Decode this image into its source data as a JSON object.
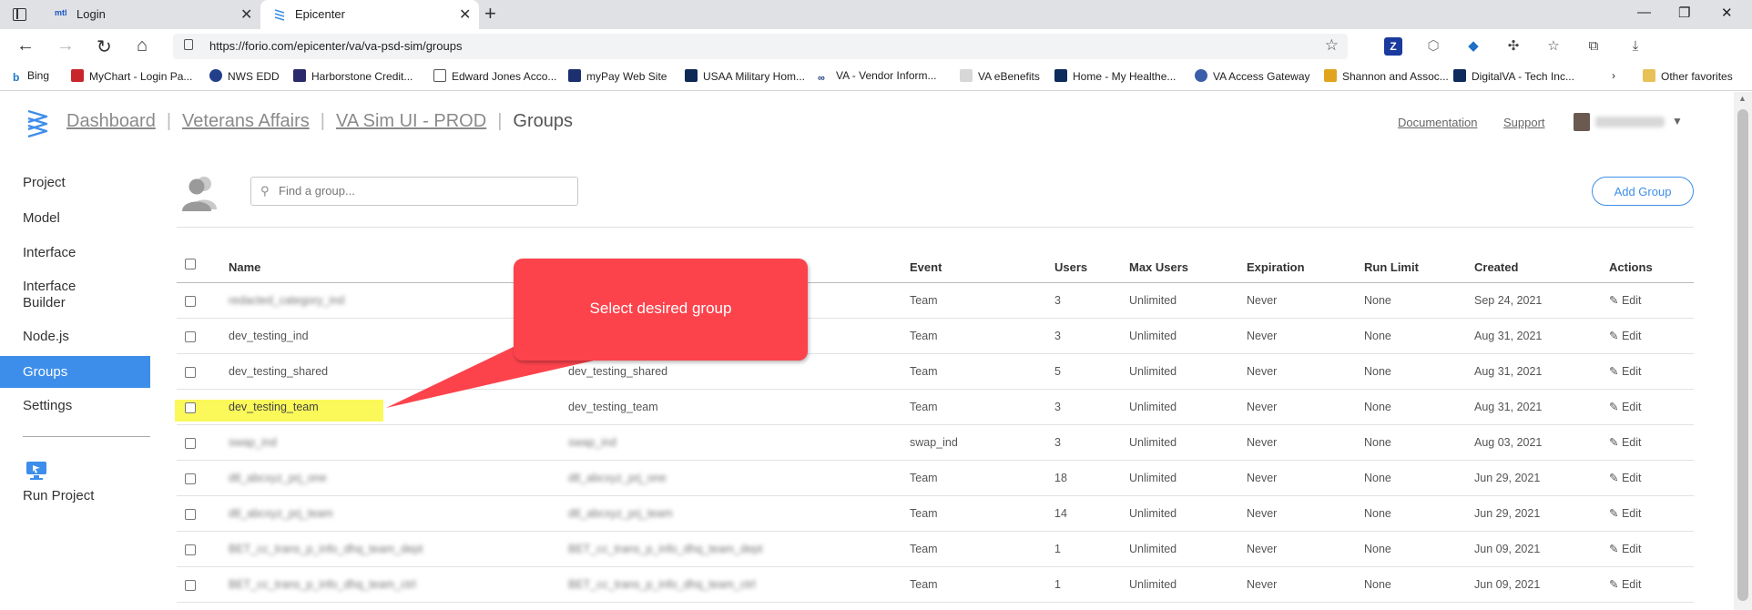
{
  "browser": {
    "tabs": [
      {
        "label": "Login",
        "favicon": "mtl"
      },
      {
        "label": "Epicenter",
        "active": true
      }
    ],
    "url": "https://forio.com/epicenter/va/va-psd-sim/groups",
    "favorites": [
      "Bing",
      "MyChart - Login Pa...",
      "NWS EDD",
      "Harborstone Credit...",
      "Edward Jones Acco...",
      "myPay Web Site",
      "USAA Military Hom...",
      "VA - Vendor Inform...",
      "VA eBenefits",
      "Home - My Healthe...",
      "VA Access Gateway",
      "Shannon and Assoc...",
      "DigitalVA - Tech Inc..."
    ],
    "other_favorites": "Other favorites"
  },
  "header": {
    "breadcrumb": {
      "dashboard": "Dashboard",
      "account": "Veterans Affairs",
      "project": "VA Sim UI - PROD",
      "current": "Groups"
    },
    "documentation": "Documentation",
    "support": "Support"
  },
  "sidebar": {
    "items": [
      {
        "label": "Project"
      },
      {
        "label": "Model"
      },
      {
        "label": "Interface"
      },
      {
        "label": "Interface Builder"
      },
      {
        "label": "Node.js"
      },
      {
        "label": "Groups",
        "active": true
      },
      {
        "label": "Settings"
      }
    ],
    "run_project": "Run Project"
  },
  "toolbar": {
    "search_placeholder": "Find a group...",
    "add_group": "Add Group"
  },
  "table": {
    "columns": [
      "Name",
      "Event",
      "Users",
      "Max Users",
      "Expiration",
      "Run Limit",
      "Created",
      "Actions"
    ],
    "edit_label": "Edit",
    "rows": [
      {
        "name": "redacted_category_ind",
        "event": "Team",
        "users": "3",
        "max_users": "Unlimited",
        "expiration": "Never",
        "run_limit": "None",
        "created": "Sep 24, 2021",
        "blurred_name": true
      },
      {
        "name": "dev_testing_ind",
        "event": "Team",
        "users": "3",
        "max_users": "Unlimited",
        "expiration": "Never",
        "run_limit": "None",
        "created": "Aug 31, 2021"
      },
      {
        "name": "dev_testing_shared",
        "display": "dev_testing_shared",
        "event": "Team",
        "users": "5",
        "max_users": "Unlimited",
        "expiration": "Never",
        "run_limit": "None",
        "created": "Aug 31, 2021"
      },
      {
        "name": "dev_testing_team",
        "display": "dev_testing_team",
        "event": "Team",
        "users": "3",
        "max_users": "Unlimited",
        "expiration": "Never",
        "run_limit": "None",
        "created": "Aug 31, 2021",
        "highlighted": true
      },
      {
        "name": "swap_ind",
        "display": "swap_ind",
        "event": "swap_ind",
        "users": "3",
        "max_users": "Unlimited",
        "expiration": "Never",
        "run_limit": "None",
        "created": "Aug 03, 2021",
        "blurred_name": true
      },
      {
        "name": "dtl_abcxyz_prj_one",
        "display": "dtl_abcxyz_prj_one",
        "event": "Team",
        "users": "18",
        "max_users": "Unlimited",
        "expiration": "Never",
        "run_limit": "None",
        "created": "Jun 29, 2021",
        "blurred_name": true
      },
      {
        "name": "dtl_abcxyz_prj_team",
        "display": "dtl_abcxyz_prj_team",
        "event": "Team",
        "users": "14",
        "max_users": "Unlimited",
        "expiration": "Never",
        "run_limit": "None",
        "created": "Jun 29, 2021",
        "blurred_name": true
      },
      {
        "name": "BET_cc_trans_p_info_dhq_team_dept",
        "display": "BET_cc_trans_p_info_dhq_team_dept",
        "event": "Team",
        "users": "1",
        "max_users": "Unlimited",
        "expiration": "Never",
        "run_limit": "None",
        "created": "Jun 09, 2021",
        "blurred_name": true
      },
      {
        "name": "BET_cc_trans_p_info_dhq_team_ctrl",
        "display": "BET_cc_trans_p_info_dhq_team_ctrl",
        "event": "Team",
        "users": "1",
        "max_users": "Unlimited",
        "expiration": "Never",
        "run_limit": "None",
        "created": "Jun 09, 2021",
        "blurred_name": true
      }
    ]
  },
  "callout": {
    "text": "Select desired group",
    "color": "#fc434c"
  },
  "highlight_color": "#fbf85a",
  "accent": "#3d8eea"
}
